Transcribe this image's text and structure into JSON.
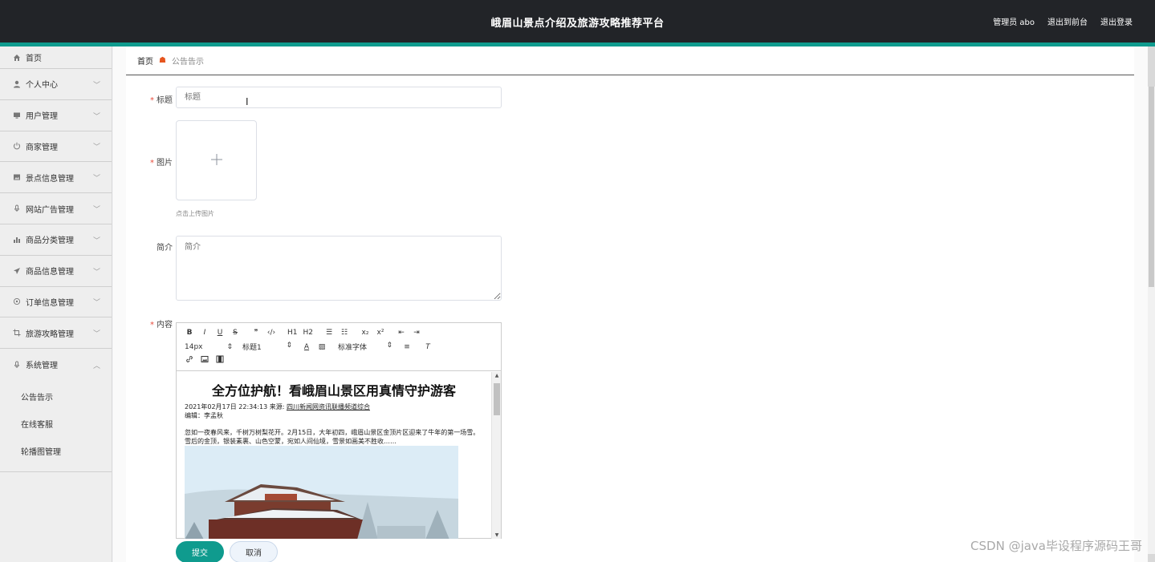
{
  "header": {
    "title": "峨眉山景点介绍及旅游攻略推荐平台",
    "user": "管理员 abo",
    "front_link": "退出到前台",
    "logout_link": "退出登录"
  },
  "sidebar": {
    "items": [
      {
        "label": "首页",
        "icon": "home-icon"
      },
      {
        "label": "个人中心",
        "icon": "user-icon"
      },
      {
        "label": "用户管理",
        "icon": "monitor-icon"
      },
      {
        "label": "商家管理",
        "icon": "power-icon"
      },
      {
        "label": "景点信息管理",
        "icon": "image-icon"
      },
      {
        "label": "网站广告管理",
        "icon": "mic-icon"
      },
      {
        "label": "商品分类管理",
        "icon": "bar-chart-icon"
      },
      {
        "label": "商品信息管理",
        "icon": "send-icon"
      },
      {
        "label": "订单信息管理",
        "icon": "settings-icon"
      },
      {
        "label": "旅游攻略管理",
        "icon": "crop-icon"
      },
      {
        "label": "系统管理",
        "icon": "mic-icon"
      }
    ],
    "sub_items": [
      "公告告示",
      "在线客服",
      "轮播图管理"
    ]
  },
  "breadcrumb": {
    "home": "首页",
    "current": "公告告示"
  },
  "form": {
    "title_label": "标题",
    "title_placeholder": "标题",
    "image_label": "图片",
    "upload_tip": "点击上传图片",
    "intro_label": "简介",
    "intro_placeholder": "简介",
    "content_label": "内容",
    "submit": "提交",
    "cancel": "取消"
  },
  "editor": {
    "toolbar_row1": [
      "B",
      "I",
      "U",
      "S",
      "❞",
      "‹/›",
      "H1",
      "H2",
      "☰",
      "☷",
      "x₂",
      "x²",
      "⇤",
      "⇥"
    ],
    "font_size": "14px",
    "heading": "标题1",
    "font_family": "标准字体",
    "article_title": "全方位护航！看峨眉山景区用真情守护游客",
    "meta_date": "2021年02月17日 22:34:13 来源:",
    "meta_source": "四川新闻网资讯联播频道综合",
    "meta_editor": "编辑：李孟秋",
    "paragraph": "忽如一夜春风来，千树万树梨花开。2月15日，大年初四，峨眉山景区金顶片区迎来了牛年的第一场雪。雪后的金顶，银装素裹、山色空蒙，宛如人间仙境，雪景如画美不胜收……"
  },
  "watermark": "CSDN @java毕设程序源码王哥"
}
